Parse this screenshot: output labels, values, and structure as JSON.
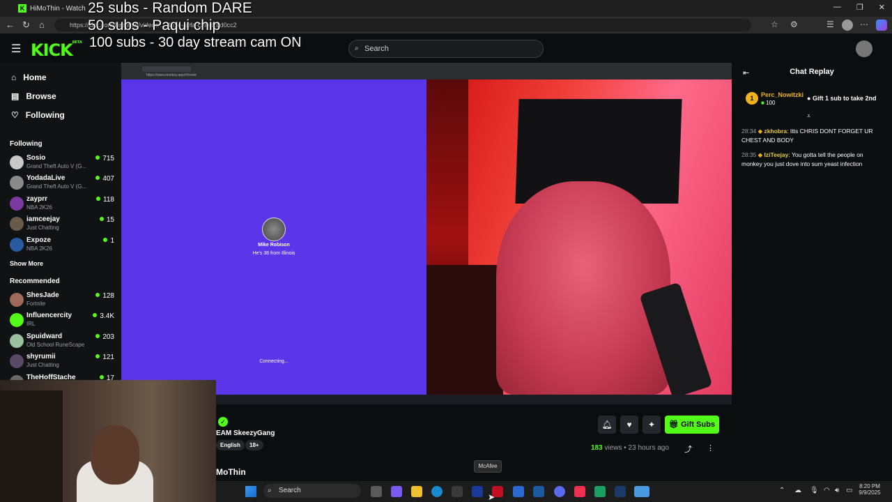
{
  "browser": {
    "tab_title": "HiMoThin - Watch",
    "url": "https://kick.com/himothin/videos/...-4e1e-a0fa-c3fed2dd0cc2"
  },
  "overlay": {
    "line1": "25 subs - Random DARE",
    "line2": "50 subs - Paqui chip",
    "line3": "100 subs - 30 day stream cam ON"
  },
  "kick": {
    "logo": "KICK",
    "logo_badge": "BETA",
    "search_placeholder": "Search"
  },
  "sidebar": {
    "nav": [
      {
        "label": "Home",
        "icon": "home-icon"
      },
      {
        "label": "Browse",
        "icon": "browse-icon"
      },
      {
        "label": "Following",
        "icon": "heart-icon"
      }
    ],
    "following_heading": "Following",
    "following": [
      {
        "name": "Sosio",
        "game": "Grand Theft Auto V (G...",
        "viewers": "715",
        "color": "#c9c9c9"
      },
      {
        "name": "YodadaLive",
        "game": "Grand Theft Auto V (G...",
        "viewers": "407",
        "color": "#8a8a8a"
      },
      {
        "name": "zayprr",
        "game": "NBA 2K26",
        "viewers": "118",
        "color": "#7a3aa0"
      },
      {
        "name": "iamceejay",
        "game": "Just Chatting",
        "viewers": "15",
        "color": "#6a5a4a"
      },
      {
        "name": "Expoze",
        "game": "NBA 2K26",
        "viewers": "1",
        "color": "#2a5aa0"
      }
    ],
    "show_more": "Show More",
    "recommended_heading": "Recommended",
    "recommended": [
      {
        "name": "ShesJade",
        "game": "Fortnite",
        "viewers": "128",
        "color": "#a06a5a"
      },
      {
        "name": "Influencercity",
        "game": "IRL",
        "viewers": "3.4K",
        "color": "#53fc18"
      },
      {
        "name": "Spuidward",
        "game": "Old School RuneScape",
        "viewers": "203",
        "color": "#9ac0a0"
      },
      {
        "name": "shyrumii",
        "game": "Just Chatting",
        "viewers": "121",
        "color": "#5a4a6a"
      },
      {
        "name": "TheHoffStache",
        "game": "",
        "viewers": "17",
        "color": "#6a6a6a"
      }
    ]
  },
  "video": {
    "inner_url": "https://www.monkey.app/#/home",
    "peer_name": "Mike Robison",
    "peer_info": "He's 38 from Illinois",
    "connecting": "Connecting..."
  },
  "stream_info": {
    "title_partial": "EAM SkeezyGang",
    "tags": [
      "English",
      "18+"
    ],
    "gift_label": "Gift Subs",
    "views": "183",
    "views_label": "views",
    "time_ago": "23 hours ago",
    "channel_partial": "MoThin"
  },
  "chat": {
    "title": "Chat Replay",
    "pinned_user": "Perc_Nowitzki",
    "pinned_count": "100",
    "pinned_rank": "1",
    "pinned_text": "Gift 1 sub to take 2nd",
    "messages": [
      {
        "time": "28:34",
        "user": "zkhobra",
        "text": "Itts CHRIS DONT FORGET UR CHEST AND BODY",
        "color": "#e8c840"
      },
      {
        "time": "28:35",
        "user": "IziTeejay",
        "text": "You gotta tell the people on monkey you just dove into sum yeast infection",
        "color": "#e8c840"
      }
    ]
  },
  "taskbar": {
    "search_label": "Search",
    "tooltip": "McAfee",
    "time": "8:20 PM",
    "date": "9/9/2025"
  }
}
